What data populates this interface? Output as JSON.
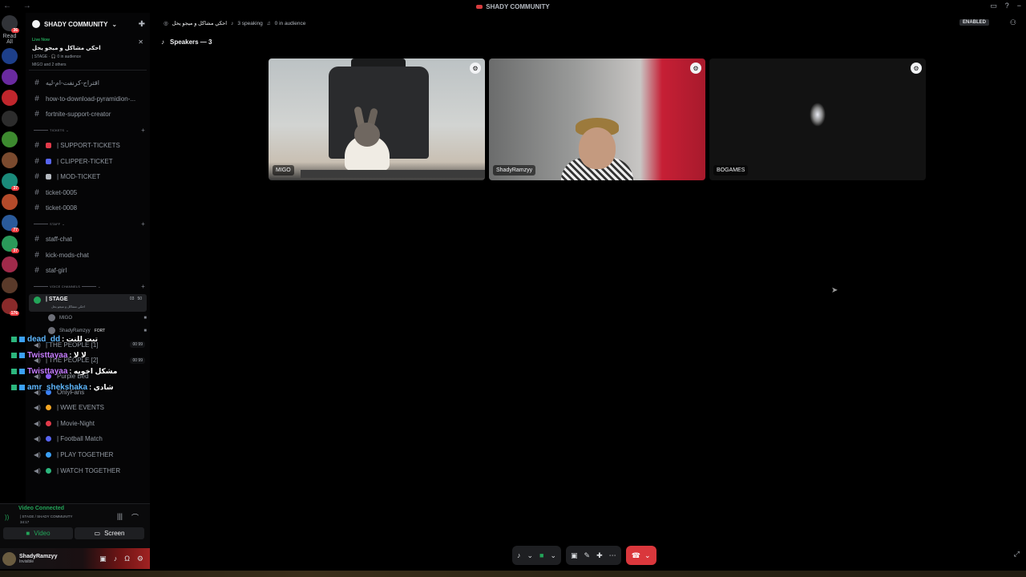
{
  "window": {
    "title": "SHADY COMMUNITY",
    "nav": "← →",
    "controls": [
      "▭",
      "?",
      "−"
    ]
  },
  "servers": {
    "read_all": "Read All",
    "items": [
      {
        "color": "#5865f2",
        "badge": "36"
      },
      {
        "color": "#1d3f8a",
        "badge": ""
      },
      {
        "color": "#6a2aa0",
        "badge": ""
      },
      {
        "color": "#c0262c",
        "badge": ""
      },
      {
        "color": "#2c2c2c",
        "badge": ""
      },
      {
        "color": "#3d8a2f",
        "badge": ""
      },
      {
        "color": "#7a4a2e",
        "badge": ""
      },
      {
        "color": "#1a8a7a",
        "badge": "37"
      },
      {
        "color": "#b44a2a",
        "badge": ""
      },
      {
        "color": "#2a5a9a",
        "badge": "77"
      },
      {
        "color": "#2a9a5a",
        "badge": "37"
      },
      {
        "color": "#a02a4a",
        "badge": ""
      },
      {
        "color": "#5a3a2a",
        "badge": ""
      },
      {
        "color": "#8a2a2a",
        "badge": "176"
      }
    ]
  },
  "guild": {
    "name": "SHADY COMMUNITY",
    "chevron": "⌄",
    "invite_icon": "✚"
  },
  "live_card": {
    "label": "Live Now",
    "title": "احكي مشاكل و ميجو يحل",
    "stage": "| STAGE · 🎧 0 in audience",
    "members": "MIGO and 2 others",
    "close": "✕"
  },
  "channels": {
    "top": [
      {
        "icon": "#",
        "name": "اقتراح-كرنفت-ام-ليه"
      },
      {
        "icon": "#",
        "name": "how-to-download-pyramidion-..."
      },
      {
        "icon": "#",
        "name": "fortnite-support-creator"
      }
    ],
    "cat_tickets": "TICKETS",
    "tickets": [
      {
        "icon": "#",
        "emoji": "#e23a4a",
        "name": "| SUPPORT-TICKETS"
      },
      {
        "icon": "#",
        "emoji": "#5865f2",
        "name": "| CLIPPER-TICKET"
      },
      {
        "icon": "#",
        "emoji": "#b5bac1",
        "name": "| MOD-TICKET"
      },
      {
        "icon": "#",
        "emoji": "",
        "name": "ticket-0005"
      },
      {
        "icon": "#",
        "emoji": "",
        "name": "ticket-0008"
      }
    ],
    "cat_staff": "STAFF",
    "staff": [
      {
        "icon": "#",
        "name": "staff-chat"
      },
      {
        "icon": "#",
        "name": "kick-mods-chat"
      },
      {
        "icon": "#",
        "name": "staf-girl"
      }
    ],
    "cat_voice": "VOICE CHANNELS",
    "stage": {
      "name": "| STAGE",
      "sub": "احكي مشاكل و ميجو يحل",
      "cam_count": "03",
      "audience": "50"
    },
    "stage_members": [
      {
        "name": "MIGO",
        "tag": ""
      },
      {
        "name": "ShadyRamzyy",
        "tag": "FORT"
      }
    ],
    "people": [
      {
        "name": "| THE PEOPLE [1]",
        "count": "00",
        "max": "99"
      },
      {
        "name": "| THE PEOPLE [2]",
        "count": "00",
        "max": "99"
      }
    ],
    "voice": [
      {
        "name": "Purple Bed",
        "emoji": "#8a5cf6"
      },
      {
        "name": "OnlyFans",
        "emoji": "#3b82f6"
      },
      {
        "name": "| WWE EVENTS",
        "emoji": "#f5a623"
      },
      {
        "name": "| Movie-Night",
        "emoji": "#e23a4a"
      },
      {
        "name": "| Football Match",
        "emoji": "#5865f2"
      },
      {
        "name": "| PLAY TOGETHER",
        "emoji": "#3ba0f5"
      },
      {
        "name": "| WATCH TOGETHER",
        "emoji": "#2cb67d"
      }
    ]
  },
  "chat_overlay": [
    {
      "user": "dead_dd",
      "msg": ": تيت للنت",
      "color": "blue"
    },
    {
      "user": "Twisttayaa",
      "msg": ": لا لا",
      "color": "purple"
    },
    {
      "user": "Twisttayaa",
      "msg": ": مشكل اخويه",
      "color": "purple"
    },
    {
      "user": "amr_shekshaka",
      "msg": ": شادي",
      "color": "blue"
    }
  ],
  "voice_panel": {
    "status": "Video Connected",
    "server": "| STAGE / SHADY COMMUNITY",
    "time": "34:17",
    "video_label": "Video",
    "screen_label": "Screen"
  },
  "user": {
    "name": "ShadyRamzyy",
    "status": "Invisible"
  },
  "stage_header": {
    "title": "احكي مشاكل و ميجو يحل",
    "speaking": "3 speaking",
    "audience": "0 in audience",
    "enabled": "ENABLED"
  },
  "speakers_label": "Speakers — 3",
  "tiles": [
    {
      "name": "MIGO"
    },
    {
      "name": "ShadyRamzyy"
    },
    {
      "name": "BOGAMES"
    }
  ]
}
